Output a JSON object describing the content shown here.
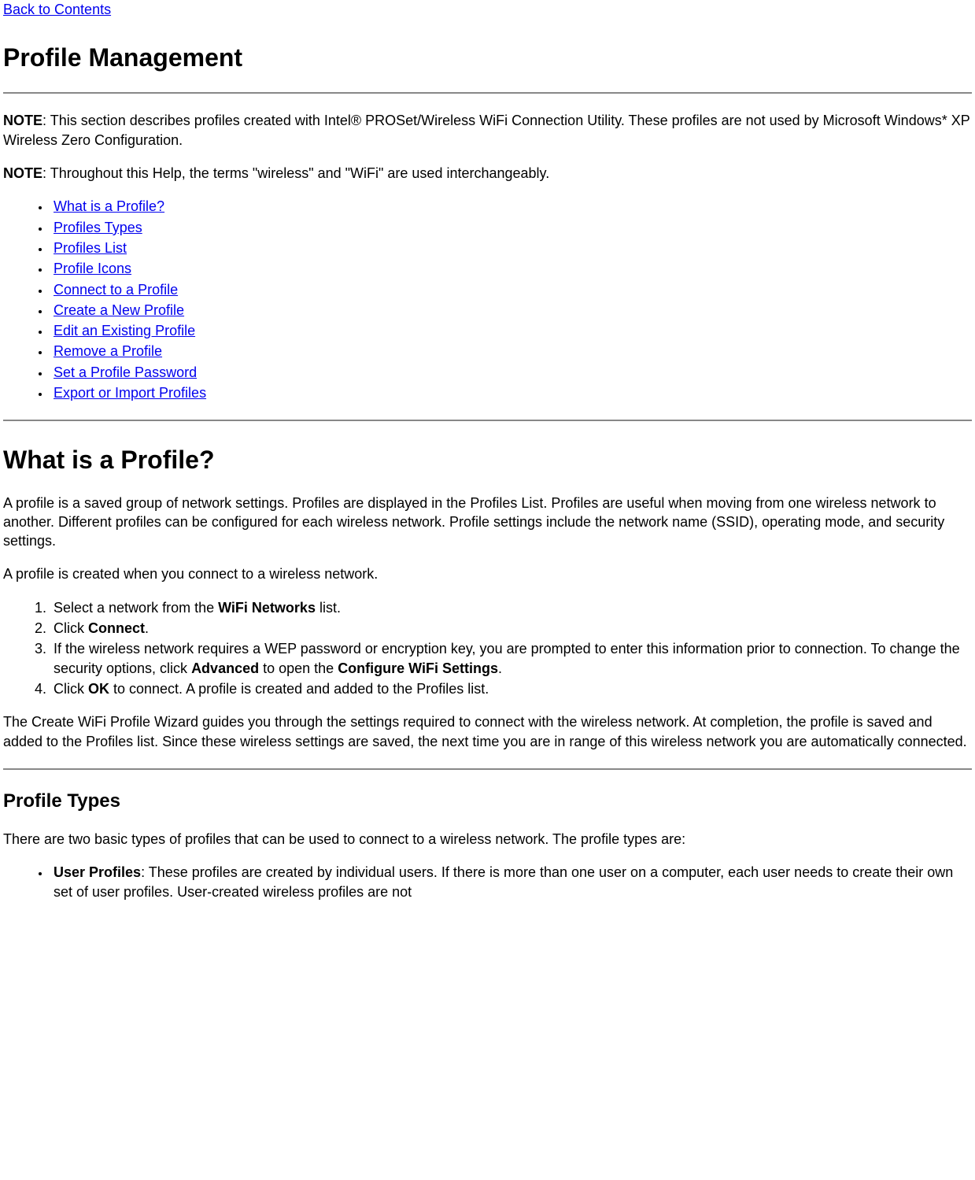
{
  "nav": {
    "back": "Back to Contents"
  },
  "title": "Profile Management",
  "note1": {
    "label": "NOTE",
    "text": ": This section describes profiles created with Intel® PROSet/Wireless WiFi Connection Utility. These profiles are not used by Microsoft Windows* XP Wireless Zero Configuration."
  },
  "note2": {
    "label": "NOTE",
    "text": ": Throughout this Help, the terms \"wireless\" and \"WiFi\" are used interchangeably."
  },
  "toc": [
    "What is a Profile?",
    "Profiles Types",
    "Profiles List",
    "Profile Icons",
    "Connect to a Profile",
    "Create a New Profile",
    "Edit an Existing Profile",
    "Remove a Profile",
    "Set a Profile Password",
    "Export or Import Profiles"
  ],
  "section1": {
    "heading": "What is a Profile?",
    "p1": "A profile is a saved group of network settings. Profiles are displayed in the Profiles List. Profiles are useful when moving from one wireless network to another. Different profiles can be configured for each wireless network. Profile settings include the network name (SSID), operating mode, and security settings.",
    "p2": "A profile is created when you connect to a wireless network.",
    "step1_a": "Select a network from the ",
    "step1_b": "WiFi Networks",
    "step1_c": " list.",
    "step2_a": "Click ",
    "step2_b": "Connect",
    "step2_c": ".",
    "step3_a": "If the wireless network requires a WEP password or encryption key, you are prompted to enter this information prior to connection. To change the security options, click ",
    "step3_b": "Advanced",
    "step3_c": " to open the ",
    "step3_d": "Configure WiFi Settings",
    "step3_e": ".",
    "step4_a": "Click ",
    "step4_b": "OK",
    "step4_c": " to connect. A profile is created and added to the Profiles list.",
    "p3": "The Create WiFi Profile Wizard guides you through the settings required to connect with the wireless network. At completion, the profile is saved and added to the Profiles list. Since these wireless settings are saved, the next time you are in range of this wireless network you are automatically connected."
  },
  "section2": {
    "heading": "Profile Types",
    "p1": "There are two basic types of profiles that can be used to connect to a wireless network. The profile types are:",
    "b1_label": "User Profiles",
    "b1_text": ": These profiles are created by individual users. If there is more than one user on a computer, each user needs to create their own set of user profiles. User-created wireless profiles are not"
  }
}
